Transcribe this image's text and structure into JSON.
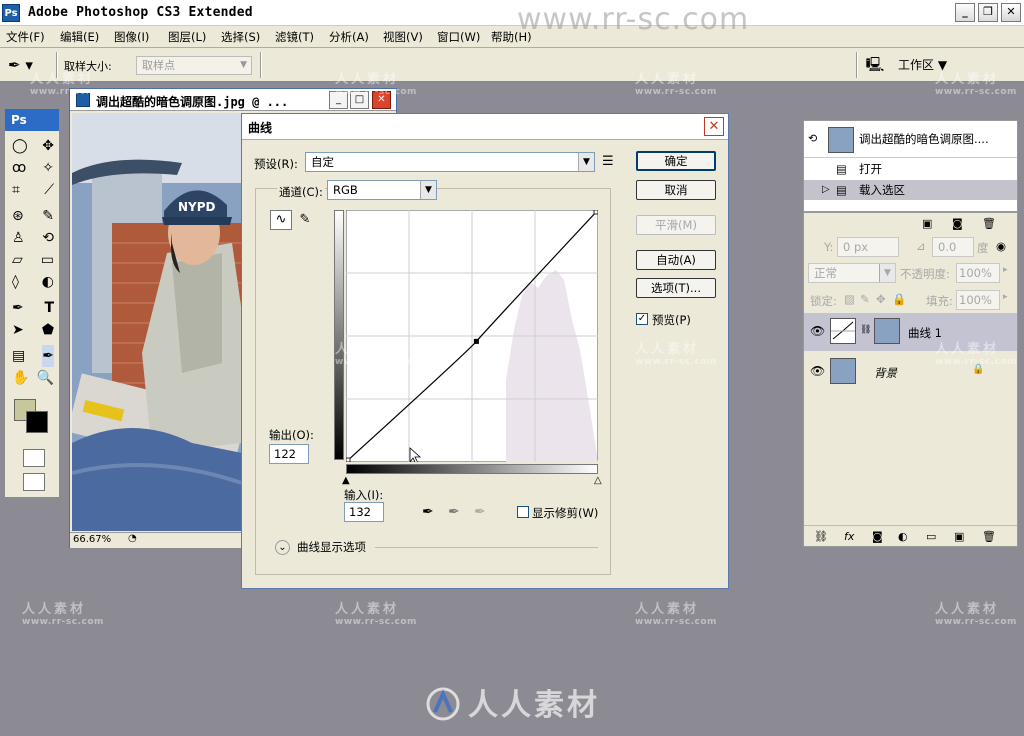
{
  "app": {
    "title": "Adobe Photoshop CS3 Extended",
    "logo": "Ps"
  },
  "window_controls": {
    "minimize": "_",
    "restore": "❐",
    "close": "✕"
  },
  "menu": [
    "文件(F)",
    "编辑(E)",
    "图像(I)",
    "图层(L)",
    "选择(S)",
    "滤镜(T)",
    "分析(A)",
    "视图(V)",
    "窗口(W)",
    "帮助(H)"
  ],
  "options_bar": {
    "sample_size_label": "取样大小:",
    "sample_size_value": "取样点",
    "workspace_label": "工作区 ▼"
  },
  "toolbox": {
    "header": "Ps",
    "foreground_color": "#c8c69c",
    "background_color": "#000000"
  },
  "document": {
    "title": "调出超酷的暗色调原图.jpg @ ...",
    "zoom": "66.67%"
  },
  "curves_dialog": {
    "title": "曲线",
    "preset_label": "预设(R):",
    "preset_value": "自定",
    "channel_label": "通道(C):",
    "channel_value": "RGB",
    "output_label": "输出(O):",
    "output_value": "122",
    "input_label": "输入(I):",
    "input_value": "132",
    "show_clipping_label": "显示修剪(W)",
    "display_options_label": "曲线显示选项",
    "buttons": {
      "ok": "确定",
      "cancel": "取消",
      "smooth": "平滑(M)",
      "auto": "自动(A)",
      "options": "选项(T)..."
    },
    "preview_label": "预览(P)",
    "preview_checked": true,
    "curve_point": {
      "input": 132,
      "output": 122
    }
  },
  "history_panel": {
    "snapshot_name": "调出超酷的暗色调原图....",
    "items": [
      "打开",
      "载入选区"
    ]
  },
  "layers_panel": {
    "y_label": "Y:",
    "y_value": "0 px",
    "angle_value": "0.0",
    "angle_unit": "度",
    "blend_mode": "正常",
    "opacity_label": "不透明度:",
    "opacity_value": "100%",
    "lock_label": "锁定:",
    "fill_label": "填充:",
    "fill_value": "100%",
    "layers": [
      {
        "name": "曲线 1"
      },
      {
        "name": "背景"
      }
    ]
  },
  "watermark": {
    "text": "人人素材",
    "url": "www.rr-sc.com",
    "big_url": "www.rr-sc.com"
  }
}
